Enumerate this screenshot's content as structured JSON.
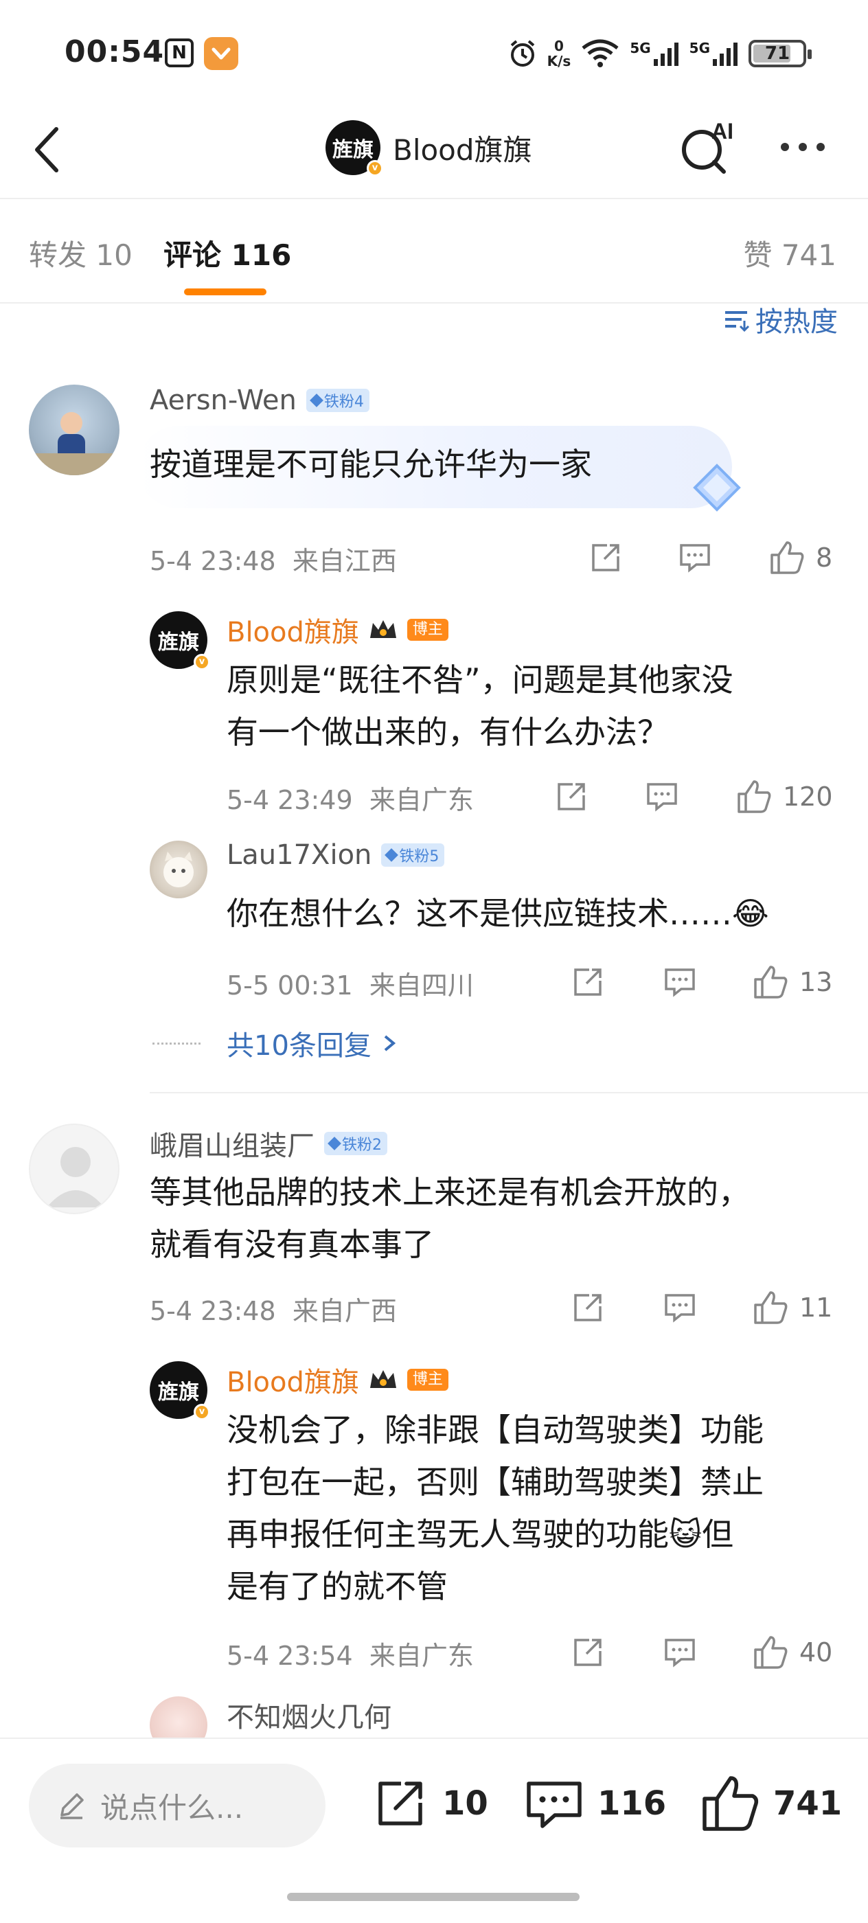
{
  "status_bar": {
    "time": "00:54",
    "nfc": "N",
    "speed_value": "0",
    "speed_unit": "K/s",
    "signal_1": "5G",
    "signal_2": "5G",
    "battery": "71"
  },
  "header": {
    "title": "Blood旗旗",
    "avatar_text": "旌旗",
    "ai_label": "AI"
  },
  "tabs": {
    "repost": "转发 10",
    "comment": "评论 116",
    "like": "赞 741",
    "active": "comment"
  },
  "sort": {
    "label": "按热度"
  },
  "comments": [
    {
      "user": "Aersn-Wen",
      "fan_badge": "铁粉4",
      "text": "按道理是不可能只允许华为一家",
      "time": "5-4 23:48",
      "location": "来自江西",
      "likes": "8",
      "replies": [
        {
          "user": "Blood旗旗",
          "role": "博主",
          "text_lines": [
            "原则是“既往不咎”，问题是其他家没",
            "有一个做出来的，有什么办法？"
          ],
          "time": "5-4 23:49",
          "location": "来自广东",
          "likes": "120"
        },
        {
          "user": "Lau17Xion",
          "fan_badge": "铁粉5",
          "text": "你在想什么？这不是供应链技术……",
          "emoji": "😂",
          "time": "5-5 00:31",
          "location": "来自四川",
          "likes": "13"
        }
      ],
      "more_replies": "共10条回复"
    },
    {
      "user": "峨眉山组装厂",
      "fan_badge": "铁粉2",
      "text_lines": [
        "等其他品牌的技术上来还是有机会开放的，",
        "就看有没有真本事了"
      ],
      "time": "5-4 23:48",
      "location": "来自广西",
      "likes": "11",
      "replies": [
        {
          "user": "Blood旗旗",
          "role": "博主",
          "text_lines": [
            "没机会了，除非跟【自动驾驶类】功能",
            "打包在一起，否则【辅助驾驶类】禁止",
            "再申报任何主驾无人驾驶的功能",
            "是有了的就不管"
          ],
          "emoji": "😺",
          "emoji_tail": "但",
          "time": "5-4 23:54",
          "location": "来自广东",
          "likes": "40"
        },
        {
          "user": "不知烟火几何"
        }
      ]
    }
  ],
  "bottom_bar": {
    "input_placeholder": "说点什么...",
    "repost_count": "10",
    "comment_count": "116",
    "like_count": "741"
  },
  "colors": {
    "accent": "#ff8200",
    "link": "#3a6fb8",
    "owner_name": "#e87a1e",
    "fan_badge_bg": "#d8e8fb"
  }
}
